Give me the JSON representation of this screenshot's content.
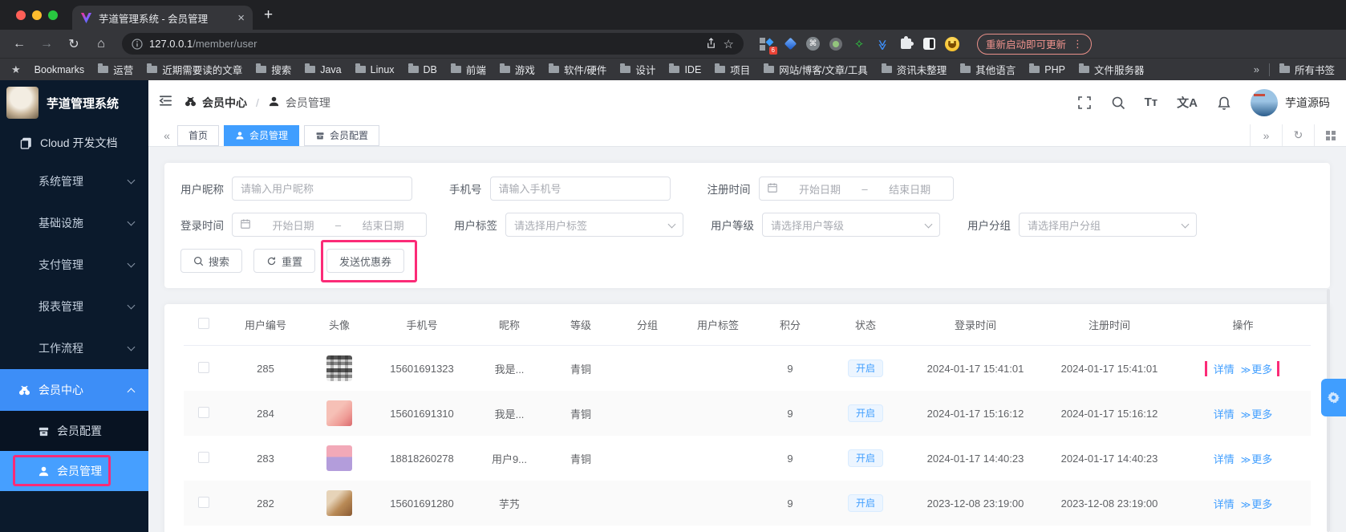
{
  "browser": {
    "tab_title": "芋道管理系统 - 会员管理",
    "close_glyph": "×",
    "new_tab_glyph": "+",
    "back_glyph": "←",
    "forward_glyph": "→",
    "reload_glyph": "↻",
    "home_glyph": "⌂",
    "url_host": "127.0.0.1",
    "url_path": "/member/user",
    "star_glyph": "☆",
    "cmd_glyph": "⌘",
    "layers_glyph": "≫",
    "star_ext_glyph": "✧",
    "extensions_badge": "6",
    "update_button": "重新启动即可更新",
    "menu_glyph": "⋮",
    "bookmarks": {
      "star_glyph": "★",
      "label": "Bookmarks",
      "items": [
        "运营",
        "近期需要读的文章",
        "搜索",
        "Java",
        "Linux",
        "DB",
        "前端",
        "游戏",
        "软件/硬件",
        "设计",
        "IDE",
        "项目",
        "网站/博客/文章/工具",
        "资讯未整理",
        "其他语言",
        "PHP",
        "文件服务器"
      ],
      "overflow_glyph": "»",
      "all_label": "所有书签"
    }
  },
  "sidebar": {
    "title": "芋道管理系统",
    "doc_link": "Cloud 开发文档",
    "groups": [
      "系统管理",
      "基础设施",
      "支付管理",
      "报表管理",
      "工作流程"
    ],
    "active_parent": "会员中心",
    "sub_config": "会员配置",
    "sub_manage": "会员管理"
  },
  "navbar": {
    "breadcrumb_1": "会员中心",
    "breadcrumb_sep": "/",
    "breadcrumb_2": "会员管理",
    "font_size_icon": "Tт",
    "translate_icon": "文A",
    "username": "芋道源码"
  },
  "tabsbar": {
    "left_arrow": "«",
    "right_arrow": "»",
    "refresh_glyph": "↻",
    "tabs": [
      {
        "label": "首页"
      },
      {
        "label": "会员管理"
      },
      {
        "label": "会员配置"
      }
    ]
  },
  "filters": {
    "nickname_label": "用户昵称",
    "nickname_placeholder": "请输入用户昵称",
    "mobile_label": "手机号",
    "mobile_placeholder": "请输入手机号",
    "register_time_label": "注册时间",
    "login_time_label": "登录时间",
    "date_start_placeholder": "开始日期",
    "date_separator": "–",
    "date_end_placeholder": "结束日期",
    "tag_label": "用户标签",
    "tag_placeholder": "请选择用户标签",
    "level_label": "用户等级",
    "level_placeholder": "请选择用户等级",
    "group_label": "用户分组",
    "group_placeholder": "请选择用户分组",
    "search_button": "搜索",
    "reset_button": "重置",
    "coupon_button": "发送优惠券"
  },
  "table": {
    "columns": [
      "用户编号",
      "头像",
      "手机号",
      "昵称",
      "等级",
      "分组",
      "用户标签",
      "积分",
      "状态",
      "登录时间",
      "注册时间",
      "操作"
    ],
    "ops": {
      "detail": "详情",
      "more_icon": "≫",
      "more": "更多"
    },
    "rows": [
      {
        "id": "285",
        "avatar": "bw-collage",
        "mobile": "15601691323",
        "nickname": "我是...",
        "level": "青铜",
        "group": "",
        "tags": "",
        "points": "9",
        "status": "开启",
        "login_time": "2024-01-17 15:41:01",
        "register_time": "2024-01-17 15:41:01",
        "annotated": true
      },
      {
        "id": "284",
        "avatar": "pink-cosmetics",
        "mobile": "15601691310",
        "nickname": "我是...",
        "level": "青铜",
        "group": "",
        "tags": "",
        "points": "9",
        "status": "开启",
        "login_time": "2024-01-17 15:16:12",
        "register_time": "2024-01-17 15:16:12",
        "annotated": false
      },
      {
        "id": "283",
        "avatar": "pink-unicorn",
        "mobile": "18818260278",
        "nickname": "用户9...",
        "level": "青铜",
        "group": "",
        "tags": "",
        "points": "9",
        "status": "开启",
        "login_time": "2024-01-17 14:40:23",
        "register_time": "2024-01-17 14:40:23",
        "annotated": false
      },
      {
        "id": "282",
        "avatar": "brown-dog",
        "mobile": "15601691280",
        "nickname": "芋艿",
        "level": "",
        "group": "",
        "tags": "",
        "points": "9",
        "status": "开启",
        "login_time": "2023-12-08 23:19:00",
        "register_time": "2023-12-08 23:19:00",
        "annotated": false
      }
    ]
  },
  "colors": {
    "accent": "#409eff",
    "annotation": "#fb2b77",
    "sidebar_bg": "#0b1a2c",
    "status_tag_text": "#409eff",
    "traffic_lights": [
      "#ff5f57",
      "#febc2e",
      "#28c840"
    ]
  }
}
